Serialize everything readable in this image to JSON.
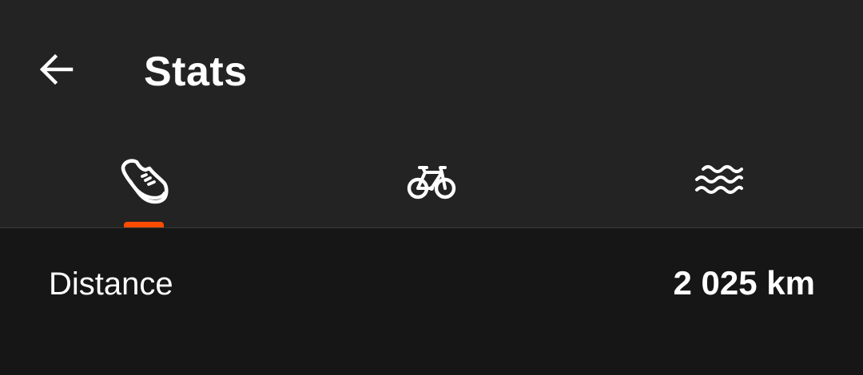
{
  "header": {
    "title": "Stats"
  },
  "tabs": [
    {
      "name": "Run",
      "icon": "running-shoe-icon",
      "active": true
    },
    {
      "name": "Ride",
      "icon": "bicycle-icon",
      "active": false
    },
    {
      "name": "Swim",
      "icon": "water-waves-icon",
      "active": false
    }
  ],
  "stats": {
    "distance_label": "Distance",
    "distance_value": "2 025 km"
  },
  "colors": {
    "accent": "#fc4c02",
    "header_bg": "#232323",
    "body_bg": "#161616",
    "text": "#ffffff"
  }
}
